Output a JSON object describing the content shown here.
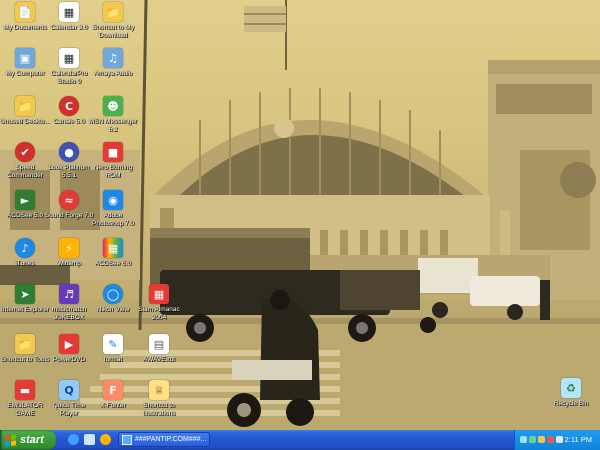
{
  "desktop": {
    "icons": [
      {
        "label": "My Documents",
        "icon": "folder-documents-icon",
        "color": "#f2c94c"
      },
      {
        "label": "Calendar 3.0",
        "icon": "calendar-icon",
        "color": "#ffffff"
      },
      {
        "label": "Shortcut to My Download",
        "icon": "folder-icon",
        "color": "#f2c94c"
      },
      {
        "label": "My Computer",
        "icon": "computer-icon",
        "color": "#6fa8dc"
      },
      {
        "label": "CalendarPro Studio 9",
        "icon": "calendar-icon",
        "color": "#ffffff"
      },
      {
        "label": "Amaya Audio",
        "icon": "audio-icon",
        "color": "#6fa8dc"
      },
      {
        "label": "Unused Deskto...",
        "icon": "folder-icon",
        "color": "#f2c94c"
      },
      {
        "label": "Canale 5.0",
        "icon": "canal-icon",
        "color": "#d32f2f"
      },
      {
        "label": "MSN Messenger 6.2",
        "icon": "msn-icon",
        "color": "#4caf50"
      },
      {
        "label": "Speed Commander",
        "icon": "speed-icon",
        "color": "#d32f2f"
      },
      {
        "label": "Look Platinum 5.5.1",
        "icon": "globe-icon",
        "color": "#3f51b5"
      },
      {
        "label": "Nero Burning ROM",
        "icon": "nero-icon",
        "color": "#e53935"
      },
      {
        "label": "ACDSee 5.0",
        "icon": "acdsee-icon",
        "color": "#2e7d32"
      },
      {
        "label": "Sound Forge 7.0",
        "icon": "soundforge-icon",
        "color": "#e53935"
      },
      {
        "label": "Adobe Photoshop 7.0",
        "icon": "photoshop-icon",
        "color": "#1e88e5"
      },
      {
        "label": "iTunes",
        "icon": "itunes-icon",
        "color": "#1e88e5"
      },
      {
        "label": "Winamp",
        "icon": "winamp-icon",
        "color": "#ffb300"
      },
      {
        "label": "ACDSee 6.0",
        "icon": "acdsee-icon",
        "color": "#e91e63"
      },
      {
        "label": "Internet Explorer",
        "icon": "explorer-icon",
        "color": "#2e7d32"
      },
      {
        "label": "musicmatch JUKEBOX",
        "icon": "musicmatch-icon",
        "color": "#673ab7"
      },
      {
        "label": "Nikon View",
        "icon": "nikon-icon",
        "color": "#1e88e5"
      },
      {
        "label": "Siam Almanac 2004",
        "icon": "almanac-icon",
        "color": "#e53935"
      },
      {
        "label": "Shortcut to Tools",
        "icon": "folder-icon",
        "color": "#f2c94c"
      },
      {
        "label": "PowerDVD",
        "icon": "powerdvd-icon",
        "color": "#e53935"
      },
      {
        "label": "format",
        "icon": "format-icon",
        "color": "#ffffff"
      },
      {
        "label": "AWAVE.rbt",
        "icon": "document-icon",
        "color": "#ffffff"
      },
      {
        "label": "EMULATOR GAME",
        "icon": "game-icon",
        "color": "#e53935"
      },
      {
        "label": "Quick Time Player",
        "icon": "quicktime-icon",
        "color": "#90caf9"
      },
      {
        "label": "X-Fonter",
        "icon": "fonter-icon",
        "color": "#ff8a65"
      },
      {
        "label": "Shortcut to Illustrations",
        "icon": "illustrations-icon",
        "color": "#ffe082"
      },
      {
        "label": "Recycle Bin",
        "icon": "recycle-bin-icon",
        "color": "#b3e5fc"
      }
    ]
  },
  "taskbar": {
    "start_label": "start",
    "task_label": "###PANTIP.COM###...",
    "clock": "2:11 PM"
  }
}
